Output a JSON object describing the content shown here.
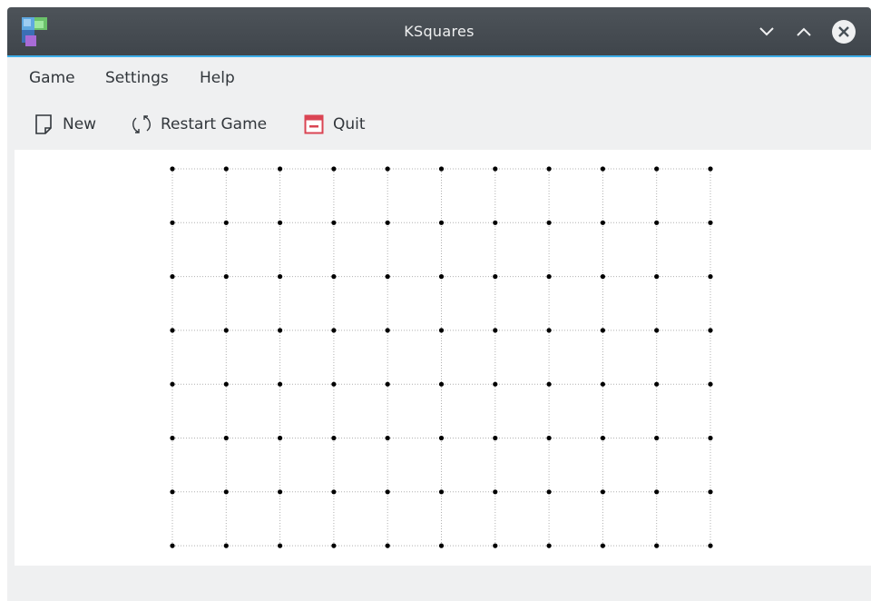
{
  "window": {
    "title": "KSquares",
    "icon": "ksquares-app-icon",
    "controls": [
      "minimize-icon",
      "maximize-icon",
      "close-icon"
    ]
  },
  "menubar": {
    "items": [
      "Game",
      "Settings",
      "Help"
    ]
  },
  "toolbar": {
    "new_label": "New",
    "restart_label": "Restart Game",
    "quit_label": "Quit",
    "icons": [
      "new-document-icon",
      "restart-icon",
      "quit-icon"
    ]
  },
  "board": {
    "dot_columns": 11,
    "dot_rows": 8,
    "line_style": "dotted",
    "colors": {
      "dot": "#000000",
      "guide_line": "#b0b0b0",
      "background": "#ffffff"
    }
  },
  "colors": {
    "titlebar": "#475057",
    "accent": "#3daee9",
    "window_bg": "#eff0f1",
    "text": "#31363b",
    "quit_red": "#da4453"
  }
}
